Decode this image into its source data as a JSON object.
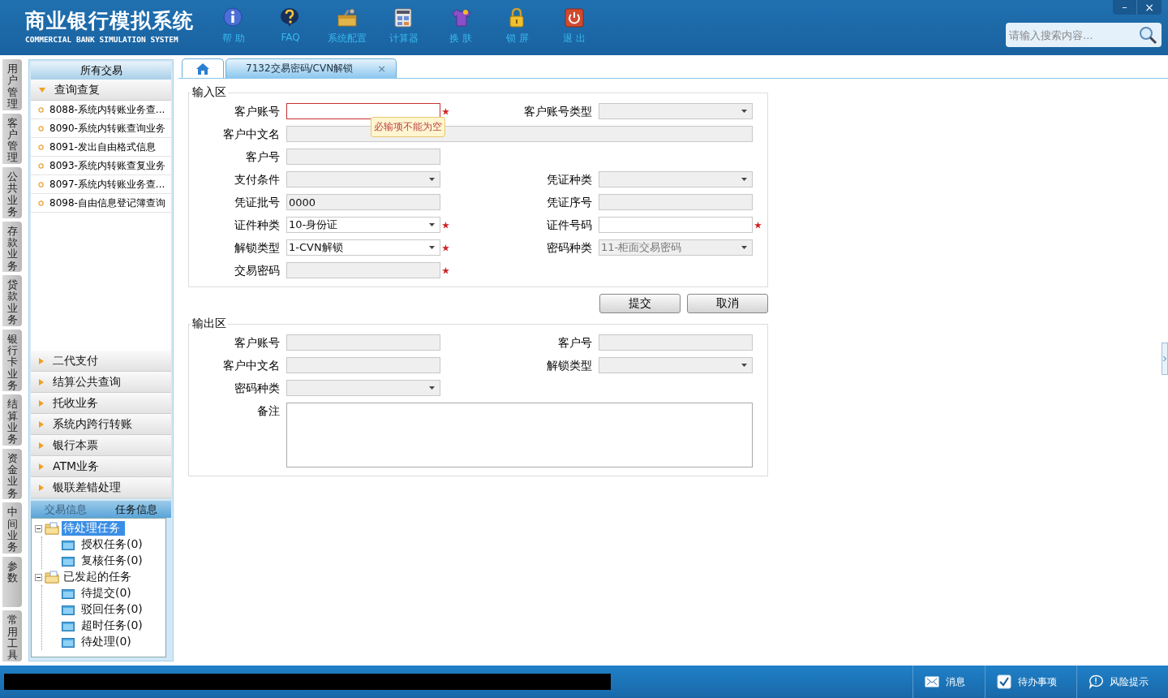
{
  "header": {
    "title": "商业银行模拟系统",
    "subtitle": "COMMERCIAL BANK SIMULATION SYSTEM",
    "toolbar": [
      {
        "label": "帮 助",
        "kind": "info"
      },
      {
        "label": "FAQ",
        "kind": "faq"
      },
      {
        "label": "系统配置",
        "kind": "config"
      },
      {
        "label": "计算器",
        "kind": "calculator"
      },
      {
        "label": "换 肤",
        "kind": "skin"
      },
      {
        "label": "锁 屏",
        "kind": "lock"
      },
      {
        "label": "退 出",
        "kind": "exit"
      }
    ],
    "search": {
      "placeholder": "请输入搜索内容..."
    },
    "window_controls": [
      {
        "label": "–",
        "kind": "minimize"
      },
      {
        "label": "×",
        "kind": "close"
      }
    ]
  },
  "side_tabs": [
    "用户管理",
    "客户管理",
    "公共业务",
    "存款业务",
    "贷款业务",
    "银行卡业务",
    "结算业务",
    "资金业务",
    "中间业务",
    "参数",
    "常用工具"
  ],
  "menu": {
    "title": "所有交易",
    "groups": [
      {
        "label": "查询查复",
        "expanded": true,
        "items": [
          "8088-系统内转账业务查...",
          "8090-系统内转账查询业务",
          "8091-发出自由格式信息",
          "8093-系统内转账查复业务",
          "8097-系统内转账业务查...",
          "8098-自由信息登记簿查询"
        ]
      },
      {
        "label": "二代支付",
        "expanded": false
      },
      {
        "label": "结算公共查询",
        "expanded": false
      },
      {
        "label": "托收业务",
        "expanded": false
      },
      {
        "label": "系统内跨行转账",
        "expanded": false
      },
      {
        "label": "银行本票",
        "expanded": false
      },
      {
        "label": "ATM业务",
        "expanded": false
      },
      {
        "label": "银联差错处理",
        "expanded": false
      }
    ]
  },
  "task_panel": {
    "tabs": [
      {
        "label": "交易信息",
        "selected": false
      },
      {
        "label": "任务信息",
        "selected": true
      }
    ],
    "tree": [
      {
        "label": "待处理任务",
        "expanded": true,
        "selected": true,
        "children": [
          {
            "label": "授权任务(0)",
            "selected": false
          },
          {
            "label": "复核任务(0)",
            "selected": false
          }
        ]
      },
      {
        "label": "已发起的任务",
        "expanded": true,
        "selected": false,
        "children": [
          {
            "label": "待提交(0)",
            "selected": false
          },
          {
            "label": "驳回任务(0)",
            "selected": false
          },
          {
            "label": "超时任务(0)",
            "selected": false
          },
          {
            "label": "待处理(0)",
            "selected": false
          }
        ]
      }
    ]
  },
  "tabs": [
    {
      "kind": "home",
      "selected": false
    },
    {
      "kind": "page",
      "label": "7132交易密码/CVN解锁",
      "close": "×",
      "selected": true
    }
  ],
  "input_area": {
    "title": "输入区",
    "rows": [
      [
        {
          "label": "客户账号",
          "kind": "text",
          "disabled": false,
          "required": true,
          "error": "必输项不能为空"
        },
        {
          "label": "客户账号类型",
          "kind": "select",
          "disabled": true,
          "required": false
        }
      ],
      [
        {
          "label": "客户中文名",
          "kind": "text",
          "disabled": true,
          "required": false,
          "wide": true
        }
      ],
      [
        {
          "label": "客户号",
          "kind": "text",
          "disabled": true,
          "required": false
        }
      ],
      [
        {
          "label": "支付条件",
          "kind": "select",
          "disabled": true,
          "required": false
        },
        {
          "label": "凭证种类",
          "kind": "select",
          "disabled": true,
          "required": false
        }
      ],
      [
        {
          "label": "凭证批号",
          "kind": "text",
          "value": "0000",
          "disabled": true,
          "required": false
        },
        {
          "label": "凭证序号",
          "kind": "text",
          "disabled": true,
          "required": false
        }
      ],
      [
        {
          "label": "证件种类",
          "kind": "select",
          "value": "10-身份证",
          "disabled": false,
          "required": true
        },
        {
          "label": "证件号码",
          "kind": "text",
          "disabled": false,
          "required": true
        }
      ],
      [
        {
          "label": "解锁类型",
          "kind": "select",
          "value": "1-CVN解锁",
          "disabled": false,
          "required": true
        },
        {
          "label": "密码种类",
          "kind": "select",
          "value": "11-柜面交易密码",
          "disabled": true,
          "required": false
        }
      ],
      [
        {
          "label": "交易密码",
          "kind": "text",
          "disabled": true,
          "required": true
        }
      ]
    ]
  },
  "actions": [
    {
      "label": "提交"
    },
    {
      "label": "取消"
    }
  ],
  "output_area": {
    "title": "输出区",
    "rows": [
      [
        {
          "label": "客户账号",
          "kind": "text",
          "disabled": true,
          "required": false
        },
        {
          "label": "客户号",
          "kind": "text",
          "disabled": true,
          "required": false
        }
      ],
      [
        {
          "label": "客户中文名",
          "kind": "text",
          "disabled": true,
          "required": false
        },
        {
          "label": "解锁类型",
          "kind": "select",
          "disabled": true,
          "required": false
        }
      ],
      [
        {
          "label": "密码种类",
          "kind": "select",
          "disabled": true,
          "required": false
        }
      ],
      [
        {
          "label": "备注",
          "kind": "textarea",
          "disabled": false,
          "required": false,
          "wide": true
        }
      ]
    ]
  },
  "status_bar": {
    "items": [
      {
        "label": "消息",
        "kind": "mail"
      },
      {
        "label": "待办事项",
        "kind": "check"
      },
      {
        "label": "风险提示",
        "kind": "chat"
      }
    ]
  }
}
